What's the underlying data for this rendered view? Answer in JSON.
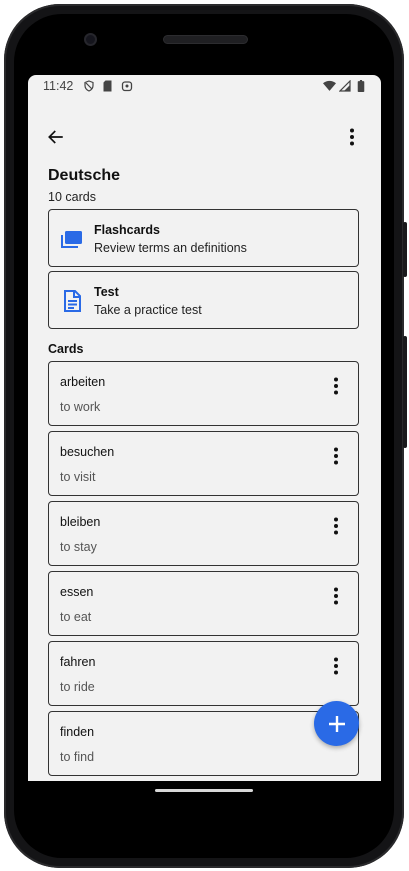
{
  "statusbar": {
    "time": "11:42"
  },
  "header": {
    "title": "Deutsche",
    "count": "10 cards"
  },
  "modes": [
    {
      "title": "Flashcards",
      "desc": "Review terms an definitions",
      "icon": "flashcards-icon"
    },
    {
      "title": "Test",
      "desc": "Take a practice test",
      "icon": "document-icon"
    }
  ],
  "cards_label": "Cards",
  "cards": [
    {
      "term": "arbeiten",
      "def": "to work"
    },
    {
      "term": "besuchen",
      "def": "to visit"
    },
    {
      "term": "bleiben",
      "def": "to stay"
    },
    {
      "term": "essen",
      "def": "to eat"
    },
    {
      "term": "fahren",
      "def": "to ride"
    },
    {
      "term": "finden",
      "def": "to find"
    }
  ],
  "colors": {
    "accent": "#2a6ae6",
    "background": "#f2f2f2",
    "border": "#333333"
  }
}
